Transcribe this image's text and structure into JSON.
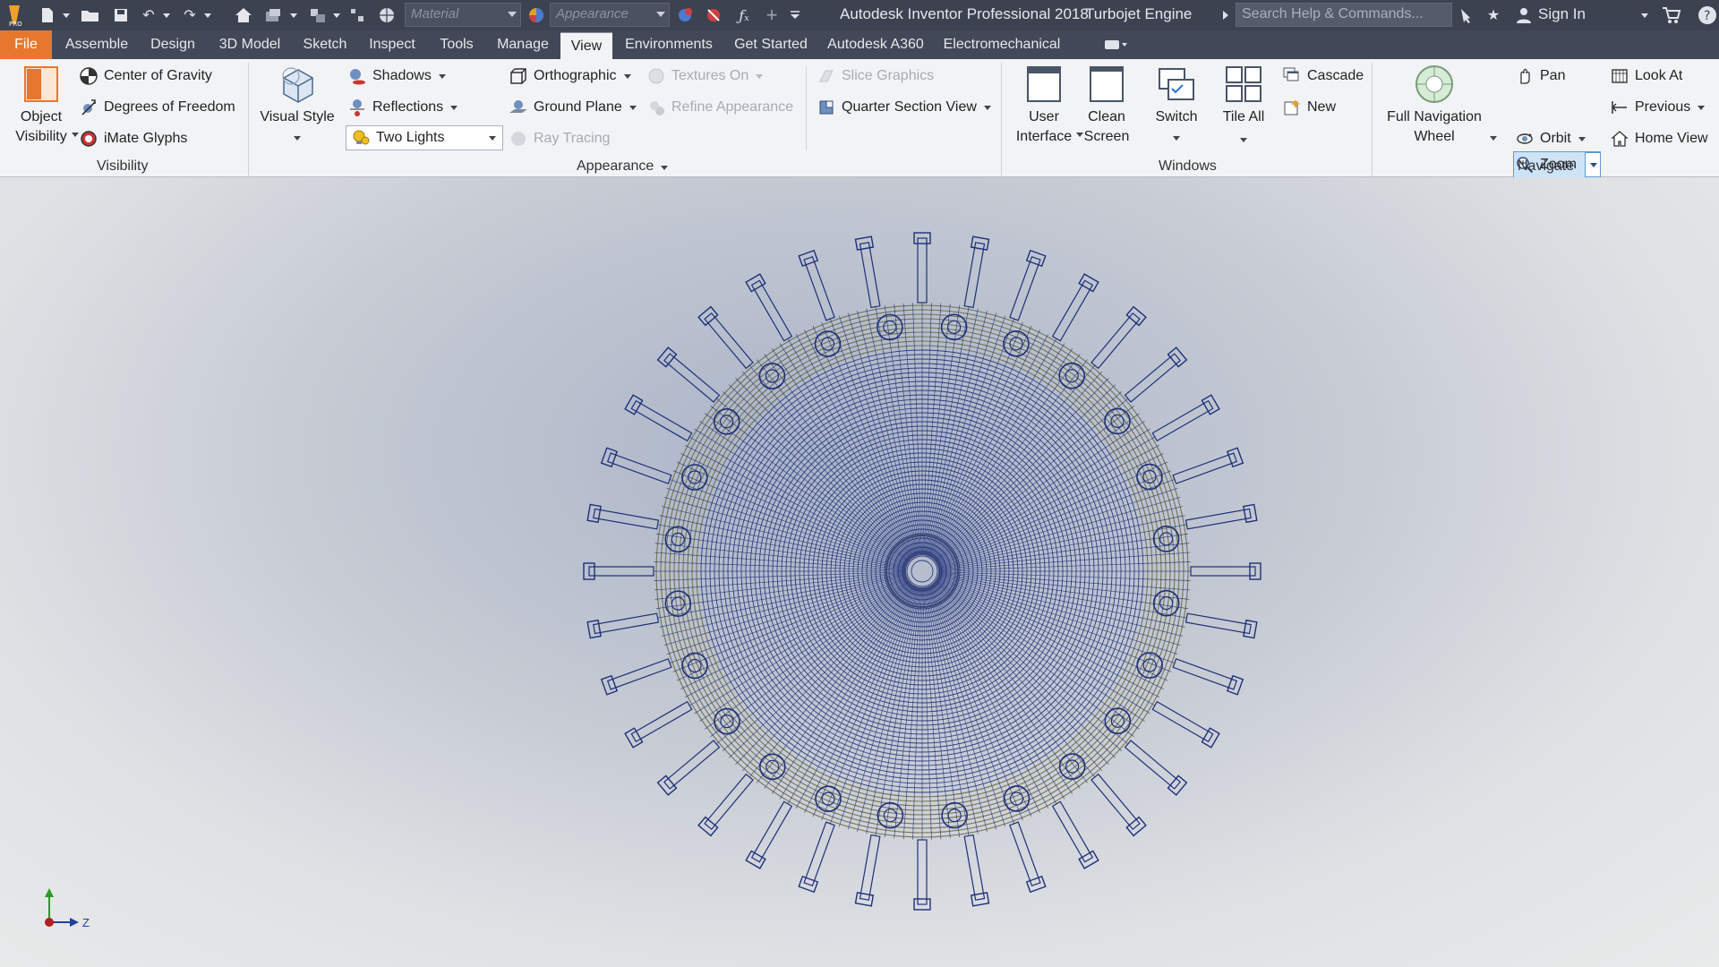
{
  "app": {
    "title": "Autodesk Inventor Professional 2018",
    "document": "Turbojet Engine",
    "search_placeholder": "Search Help & Commands...",
    "sign_in": "Sign In",
    "material_placeholder": "Material",
    "appearance_placeholder": "Appearance"
  },
  "tabs": [
    "File",
    "Assemble",
    "Design",
    "3D Model",
    "Sketch",
    "Inspect",
    "Tools",
    "Manage",
    "View",
    "Environments",
    "Get Started",
    "Autodesk A360",
    "Electromechanical"
  ],
  "active_tab": "View",
  "ribbon": {
    "visibility": {
      "label": "Visibility",
      "object_visibility": [
        "Object",
        "Visibility"
      ],
      "center_of_gravity": "Center of Gravity",
      "degrees_of_freedom": "Degrees of Freedom",
      "imate_glyphs": "iMate Glyphs"
    },
    "appearance": {
      "label": "Appearance",
      "visual_style": "Visual Style",
      "shadows": "Shadows",
      "reflections": "Reflections",
      "lighting": "Two Lights",
      "orthographic": "Orthographic",
      "ground_plane": "Ground Plane",
      "textures_on": "Textures On",
      "refine_appearance": "Refine Appearance",
      "ray_tracing": "Ray Tracing",
      "slice_graphics": "Slice Graphics",
      "quarter_section_view": "Quarter Section View"
    },
    "windows": {
      "label": "Windows",
      "user_interface": [
        "User",
        "Interface"
      ],
      "clean_screen": [
        "Clean",
        "Screen"
      ],
      "switch": "Switch",
      "tile_all": "Tile All",
      "cascade": "Cascade",
      "new": "New"
    },
    "navigate": {
      "label": "Navigate",
      "full_navigation_wheel": [
        "Full Navigation",
        "Wheel"
      ],
      "pan": "Pan",
      "zoom": "Zoom",
      "orbit": "Orbit",
      "look_at": "Look At",
      "previous": "Previous",
      "home_view": "Home View"
    }
  },
  "viewport": {
    "axis_label": "Z"
  },
  "colors": {
    "titlebar": "#3c4250",
    "file_tab": "#e8772e",
    "wireframe_blue": "#1e2f78",
    "wireframe_olive": "#6b6a45"
  }
}
